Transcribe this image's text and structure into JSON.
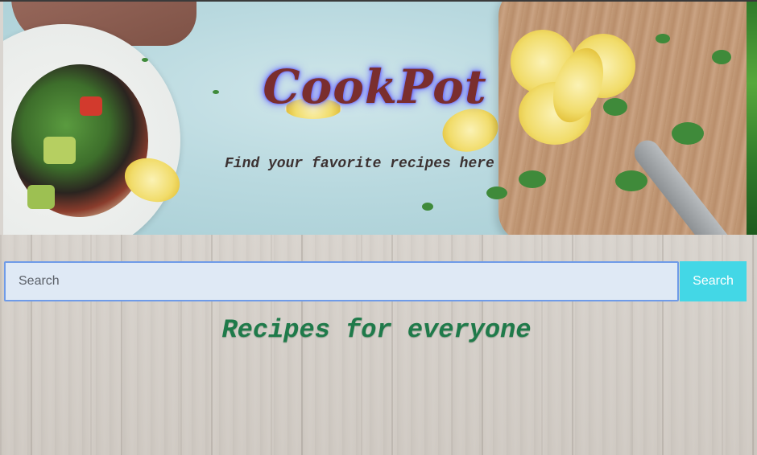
{
  "hero": {
    "title": "CookPot",
    "subtitle": "Find your favorite recipes here"
  },
  "search": {
    "placeholder": "Search",
    "value": "",
    "button_label": "Search"
  },
  "main": {
    "heading": "Recipes for everyone"
  },
  "colors": {
    "title": "#7a2e2e",
    "title_glow": "#6d6cff",
    "search_button": "#43d7e6",
    "search_border": "#6f9be8",
    "heading": "#1f7a4a"
  }
}
